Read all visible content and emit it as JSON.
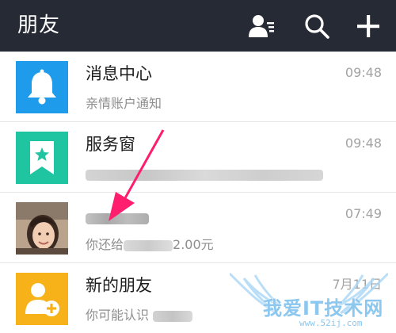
{
  "header": {
    "title": "朋友",
    "icons": {
      "contacts": "contacts-icon",
      "search": "search-icon",
      "add": "plus-icon"
    },
    "background": "#262a35"
  },
  "conversations": [
    {
      "name": "消息中心",
      "time": "09:48",
      "preview": "亲情账户通知",
      "avatar": "bell-icon",
      "avatar_color": "#1e9bea"
    },
    {
      "name": "服务窗",
      "time": "09:48",
      "preview": "",
      "avatar": "star-bookmark-icon",
      "avatar_color": "#1fc4a0"
    },
    {
      "name": "",
      "time": "07:49",
      "preview_prefix": "你还给",
      "preview_suffix": "2.00元",
      "avatar": "user-photo"
    },
    {
      "name": "新的朋友",
      "time": "7月11日",
      "preview": "你可能认识",
      "avatar": "add-friend-icon",
      "avatar_color": "#f7b21a"
    }
  ],
  "watermark": {
    "text": "我爱IT技术网",
    "url": "www.52ij.com"
  },
  "annotation": {
    "icon": "pointer-arrow",
    "color": "#ff1e6e"
  }
}
